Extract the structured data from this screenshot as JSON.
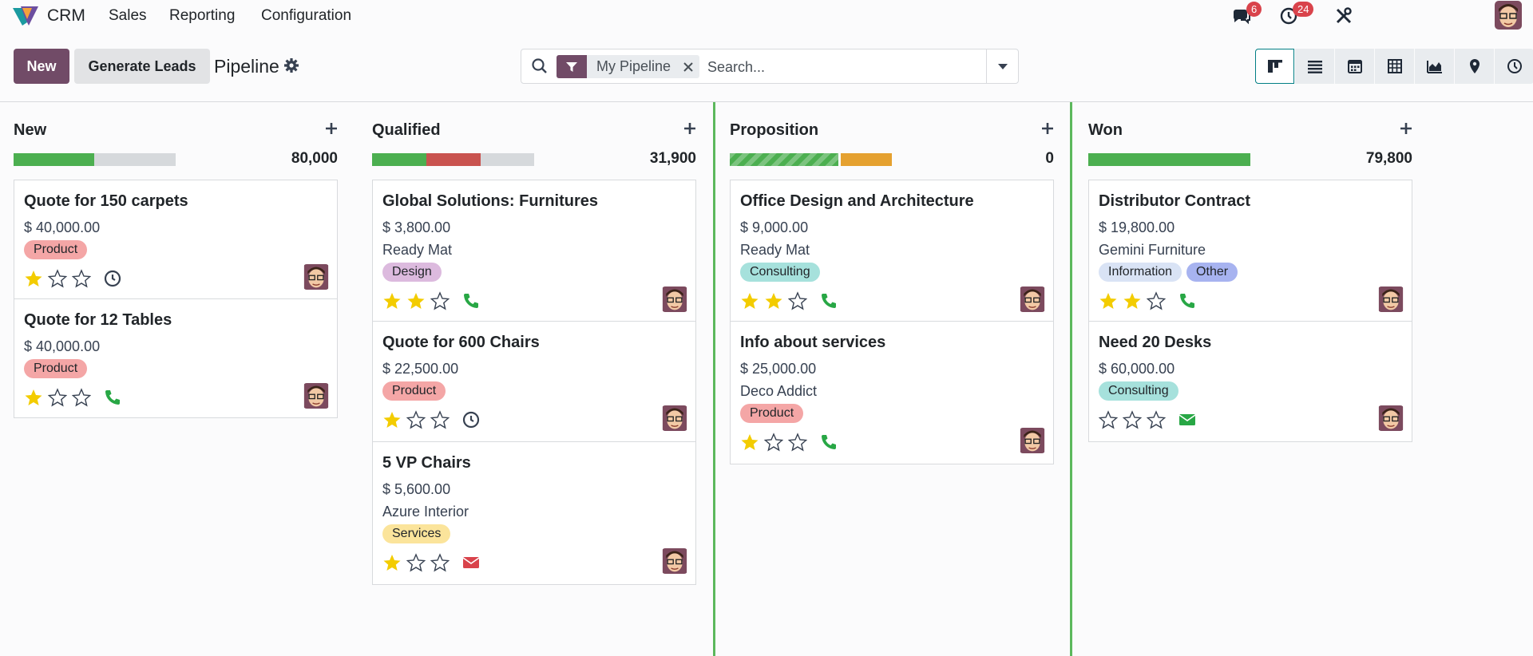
{
  "app": {
    "name": "CRM"
  },
  "menu": [
    "Sales",
    "Reporting",
    "Configuration"
  ],
  "systray": {
    "messages_count": "6",
    "activities_count": "24"
  },
  "control_panel": {
    "new_label": "New",
    "generate_label": "Generate Leads",
    "title": "Pipeline",
    "facet_label": "My Pipeline",
    "search_placeholder": "Search..."
  },
  "views": [
    "kanban-icon",
    "list-icon",
    "calendar-icon",
    "pivot-icon",
    "graph-icon",
    "map-pin-icon",
    "activity-clock-icon"
  ],
  "colors": {
    "brand": "#714b67",
    "progress_green": "#4caf50",
    "progress_red": "#c9534f",
    "progress_orange": "#e5a130",
    "progress_grey": "#d6d9dc",
    "star_gold": "#f3cc00",
    "phone_green": "#28a745",
    "email_red": "#d9434b",
    "email_green": "#28a745",
    "tag_product": "#f4a6a6",
    "tag_design": "#dcbade",
    "tag_consulting": "#a6e1dc",
    "tag_services": "#fbe49b",
    "tag_information": "#d9e3f5",
    "tag_other": "#a7b3f0"
  },
  "columns": [
    {
      "title": "New",
      "total": "80,000",
      "cards": [
        {
          "title": "Quote for 150 carpets",
          "amount": "$ 40,000.00",
          "partner": "",
          "tags": [
            "Product"
          ],
          "stars": 1,
          "activity": "clock-icon"
        },
        {
          "title": "Quote for 12 Tables",
          "amount": "$ 40,000.00",
          "partner": "",
          "tags": [
            "Product"
          ],
          "stars": 1,
          "activity": "phone-icon"
        }
      ]
    },
    {
      "title": "Qualified",
      "total": "31,900",
      "cards": [
        {
          "title": "Global Solutions: Furnitures",
          "amount": "$ 3,800.00",
          "partner": "Ready Mat",
          "tags": [
            "Design"
          ],
          "stars": 2,
          "activity": "phone-icon"
        },
        {
          "title": "Quote for 600 Chairs",
          "amount": "$ 22,500.00",
          "partner": "",
          "tags": [
            "Product"
          ],
          "stars": 1,
          "activity": "clock-icon"
        },
        {
          "title": "5 VP Chairs",
          "amount": "$ 5,600.00",
          "partner": "Azure Interior",
          "tags": [
            "Services"
          ],
          "stars": 1,
          "activity": "email-icon"
        }
      ]
    },
    {
      "title": "Proposition",
      "total": "0",
      "cards": [
        {
          "title": "Office Design and Architecture",
          "amount": "$ 9,000.00",
          "partner": "Ready Mat",
          "tags": [
            "Consulting"
          ],
          "stars": 2,
          "activity": "phone-icon"
        },
        {
          "title": "Info about services",
          "amount": "$ 25,000.00",
          "partner": "Deco Addict",
          "tags": [
            "Product"
          ],
          "stars": 1,
          "activity": "phone-icon"
        }
      ]
    },
    {
      "title": "Won",
      "total": "79,800",
      "cards": [
        {
          "title": "Distributor Contract",
          "amount": "$ 19,800.00",
          "partner": "Gemini Furniture",
          "tags": [
            "Information",
            "Other"
          ],
          "stars": 2,
          "activity": "phone-icon"
        },
        {
          "title": "Need 20 Desks",
          "amount": "$ 60,000.00",
          "partner": "",
          "tags": [
            "Consulting"
          ],
          "stars": 0,
          "activity": "email-green-icon"
        }
      ]
    }
  ]
}
